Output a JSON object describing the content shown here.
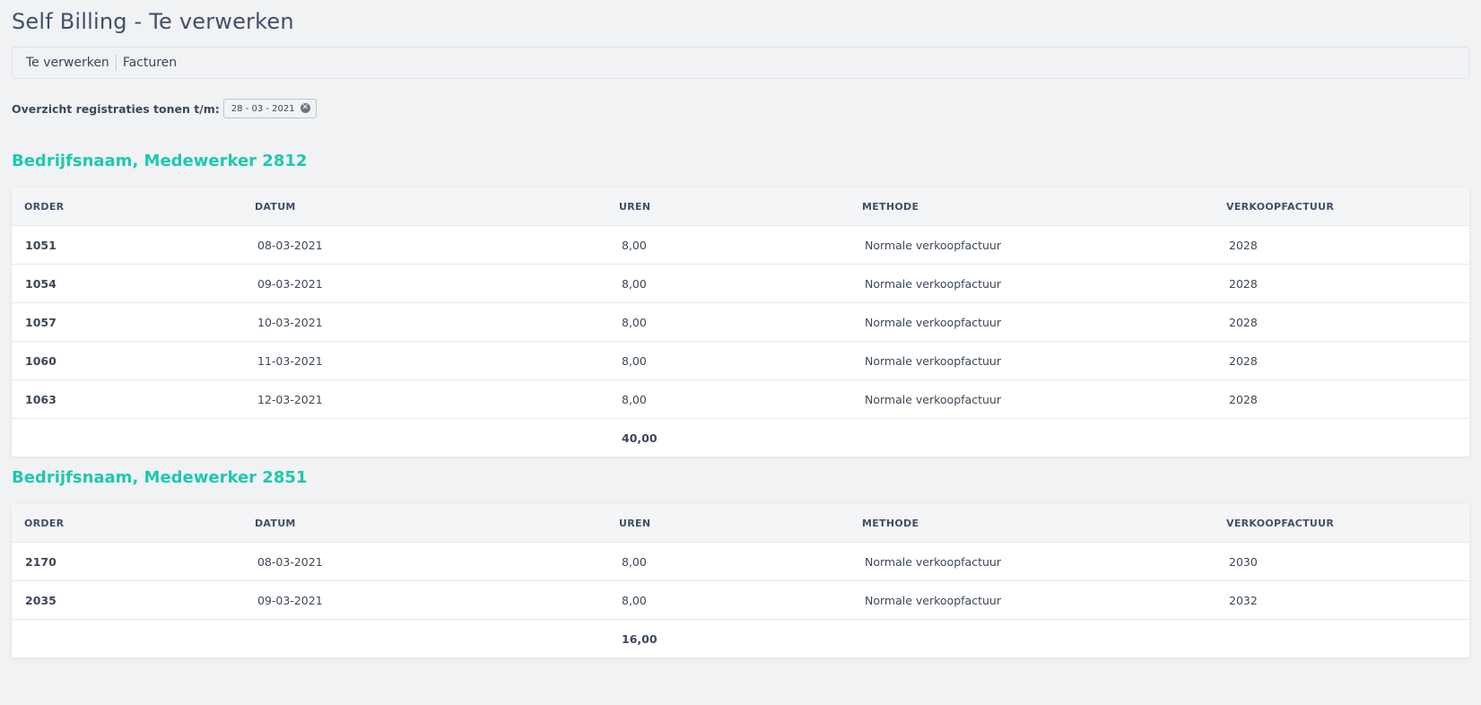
{
  "page": {
    "title": "Self Billing - Te verwerken"
  },
  "tabs": [
    {
      "label": "Te verwerken"
    },
    {
      "label": "Facturen"
    }
  ],
  "filter": {
    "label": "Overzicht registraties tonen t/m:",
    "date": "28 - 03 - 2021",
    "clear_icon": "close-circle-icon"
  },
  "columns": {
    "order": "ORDER",
    "datum": "DATUM",
    "uren": "UREN",
    "methode": "METHODE",
    "verkoopfactuur": "VERKOOPFACTUUR"
  },
  "groups": [
    {
      "title": "Bedrijfsnaam, Medewerker 2812",
      "rows": [
        {
          "order": "1051",
          "datum": "08-03-2021",
          "uren": "8,00",
          "methode": "Normale verkoopfactuur",
          "verkoopfactuur": "2028"
        },
        {
          "order": "1054",
          "datum": "09-03-2021",
          "uren": "8,00",
          "methode": "Normale verkoopfactuur",
          "verkoopfactuur": "2028"
        },
        {
          "order": "1057",
          "datum": "10-03-2021",
          "uren": "8,00",
          "methode": "Normale verkoopfactuur",
          "verkoopfactuur": "2028"
        },
        {
          "order": "1060",
          "datum": "11-03-2021",
          "uren": "8,00",
          "methode": "Normale verkoopfactuur",
          "verkoopfactuur": "2028"
        },
        {
          "order": "1063",
          "datum": "12-03-2021",
          "uren": "8,00",
          "methode": "Normale verkoopfactuur",
          "verkoopfactuur": "2028"
        }
      ],
      "total_uren": "40,00"
    },
    {
      "title": "Bedrijfsnaam, Medewerker 2851",
      "rows": [
        {
          "order": "2170",
          "datum": "08-03-2021",
          "uren": "8,00",
          "methode": "Normale verkoopfactuur",
          "verkoopfactuur": "2030"
        },
        {
          "order": "2035",
          "datum": "09-03-2021",
          "uren": "8,00",
          "methode": "Normale verkoopfactuur",
          "verkoopfactuur": "2032"
        }
      ],
      "total_uren": "16,00"
    }
  ],
  "colors": {
    "accent": "#1ec8b0",
    "title": "#3f5068",
    "background": "#f0f2f4"
  }
}
